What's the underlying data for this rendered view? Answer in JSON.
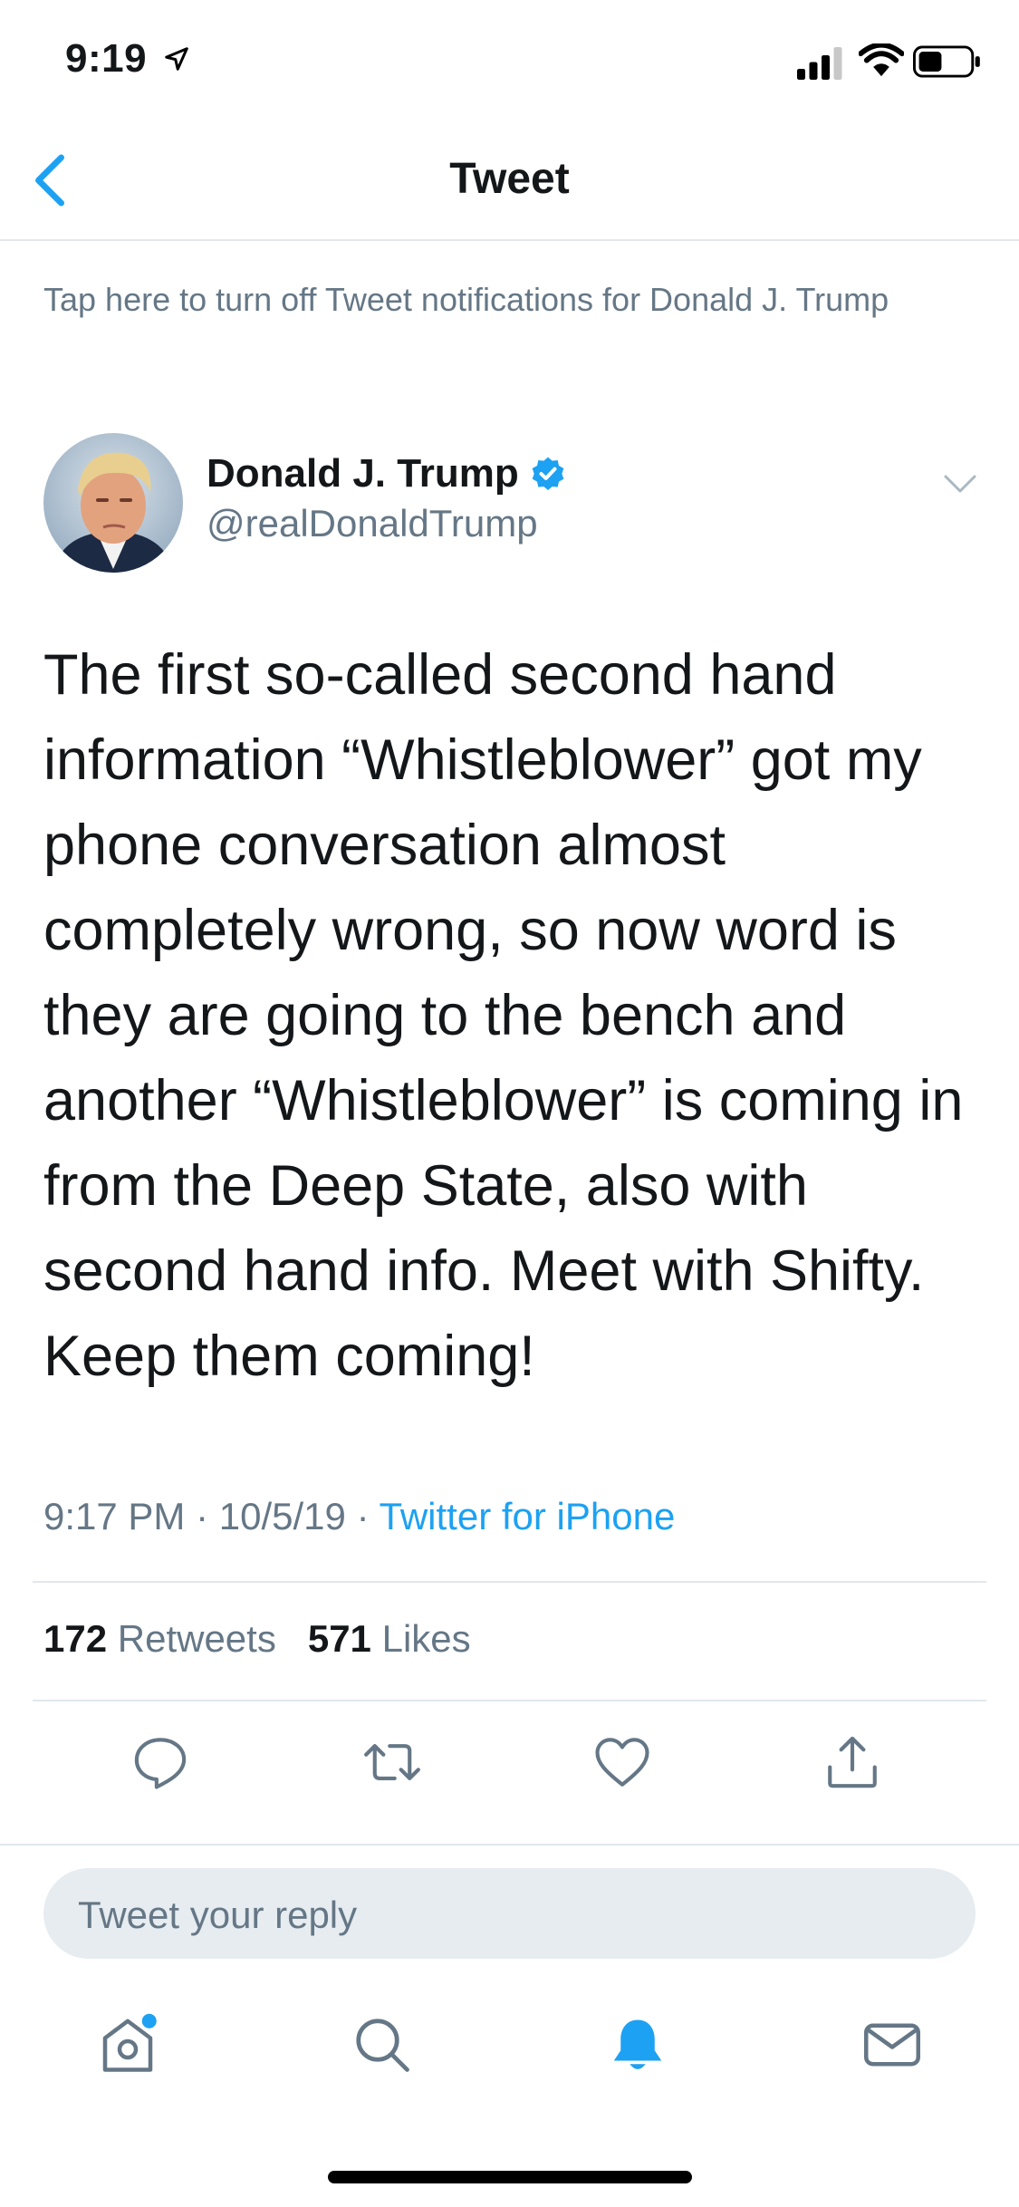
{
  "status": {
    "time": "9:19"
  },
  "nav": {
    "title": "Tweet"
  },
  "notification_banner": "Tap here to turn off Tweet notifications for Donald J. Trump",
  "author": {
    "name": "Donald J. Trump",
    "handle": "@realDonaldTrump",
    "verified": true
  },
  "tweet": {
    "text": "The first so-called second hand information “Whistleblower” got my phone conversation almost completely wrong, so now word is they are going to the bench and another “Whistleblower” is coming in from the Deep State, also with second hand info. Meet with Shifty. Keep them coming!",
    "time": "9:17 PM",
    "date": "10/5/19",
    "separator": "·",
    "source": "Twitter for iPhone"
  },
  "stats": {
    "retweets_count": "172",
    "retweets_label": "Retweets",
    "likes_count": "571",
    "likes_label": "Likes"
  },
  "actions": [
    "reply-icon",
    "retweet-icon",
    "like-icon",
    "share-icon"
  ],
  "reply": {
    "placeholder": "Tweet your reply"
  },
  "tab_bar": {
    "items": [
      "home-icon",
      "search-icon",
      "notifications-icon",
      "messages-icon"
    ],
    "active": "notifications-icon",
    "home_has_new": true
  },
  "colors": {
    "accent": "#1da1f2",
    "text": "#14171a",
    "secondary": "#657786",
    "divider": "#e1e8ed",
    "reply_bg": "#e6ecf0"
  }
}
